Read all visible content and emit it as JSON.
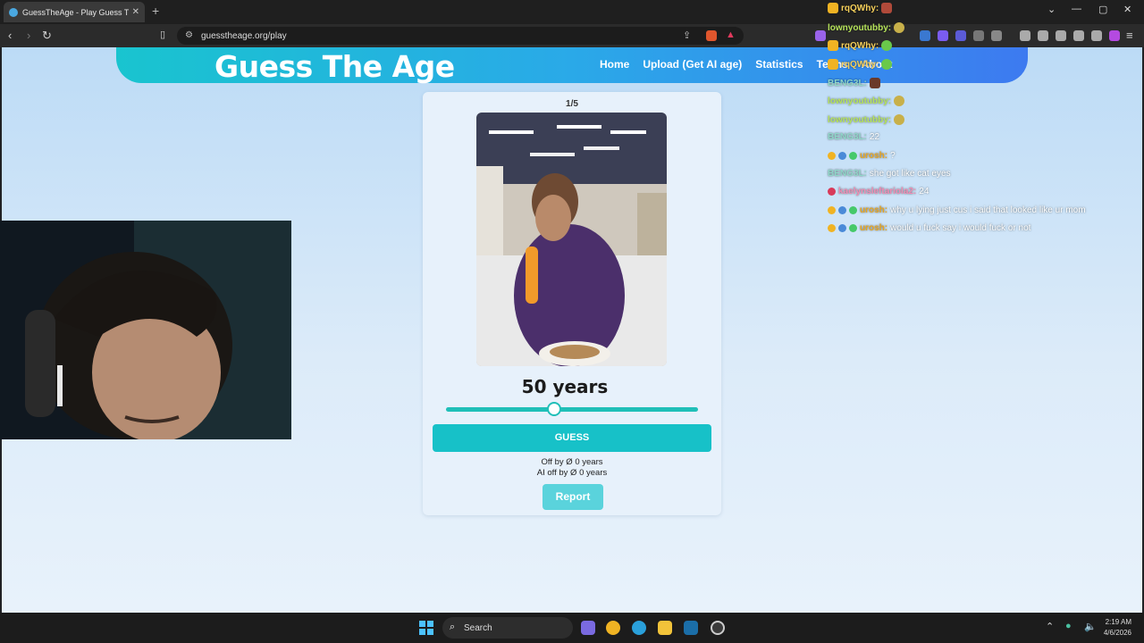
{
  "browser": {
    "tab_title": "GuessTheAge - Play Guess The A",
    "tab_close": "✕",
    "new_tab": "+",
    "url": "guesstheage.org/play",
    "min": "—",
    "max": "▢",
    "close": "✕",
    "chevron": "⌄"
  },
  "site": {
    "logo": "Guess The Age",
    "nav": [
      "Home",
      "Upload (Get AI age)",
      "Statistics",
      "Terms",
      "About"
    ]
  },
  "game": {
    "counter": "1/5",
    "age_display": "50 years",
    "slider_fraction": 0.43,
    "guess_button": "GUESS",
    "off_by": "Off by Ø 0 years",
    "ai_off_by": "AI off by Ø 0 years",
    "report_button": "Report"
  },
  "chat": [
    {
      "user": "rqQWhy:",
      "text": "",
      "color": "#f6d05a"
    },
    {
      "user": "lownyoutubby:",
      "text": "",
      "color": "#b6e35a"
    },
    {
      "user": "rqQWhy:",
      "text": "",
      "color": "#f6d05a"
    },
    {
      "user": "rqQWhy:",
      "text": "",
      "color": "#f6d05a"
    },
    {
      "user": "BENG3L:",
      "text": "",
      "color": "#8fd6c8"
    },
    {
      "user": "lownyoutubby:",
      "text": "",
      "color": "#b6e35a"
    },
    {
      "user": "lownyoutubby:",
      "text": "",
      "color": "#b6e35a"
    },
    {
      "user": "BENG3L:",
      "text": "22",
      "color": "#8fd6c8"
    },
    {
      "user": "urosh:",
      "text": "?",
      "color": "#e6a623"
    },
    {
      "user": "BENG3L:",
      "text": "she got like cat eyes",
      "color": "#8fd6c8"
    },
    {
      "user": "kaelynsleftariola2:",
      "text": "24",
      "color": "#f08cb4"
    },
    {
      "user": "urosh:",
      "text": "why u lying just cus i said that looked like ur mom",
      "color": "#e6a623"
    },
    {
      "user": "urosh:",
      "text": "would u fuck say i would fuck or not",
      "color": "#e6a623"
    }
  ],
  "taskbar": {
    "search": "Search",
    "time": "2:19 AM",
    "date": "4/6/2026"
  }
}
